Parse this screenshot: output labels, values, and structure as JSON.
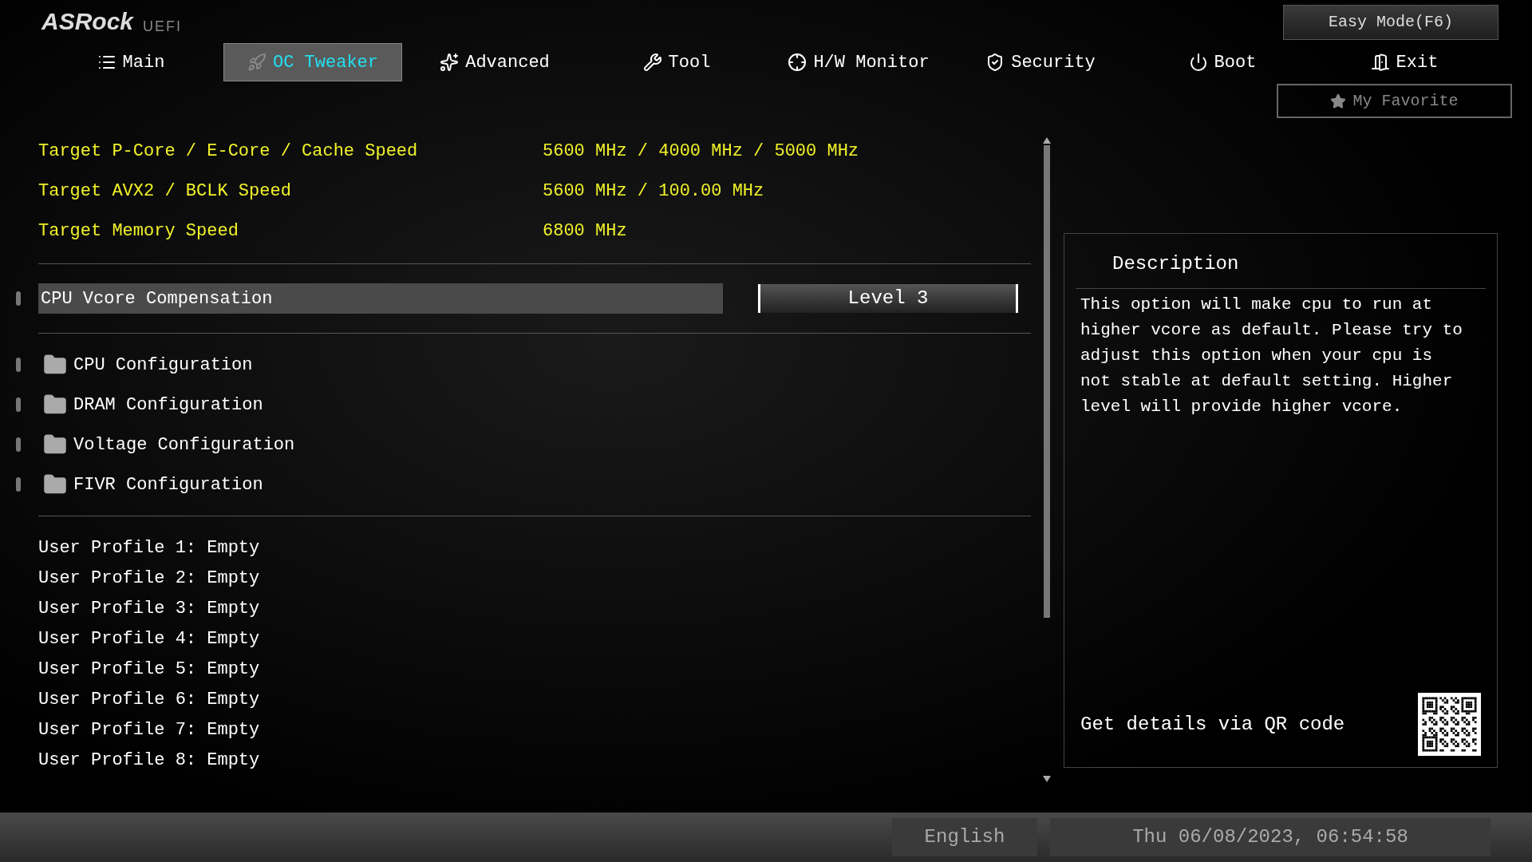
{
  "header": {
    "logo": "ASRock",
    "logo_suffix": "UEFI",
    "easy_mode": "Easy Mode(F6)",
    "favorite": "My Favorite"
  },
  "tabs": [
    {
      "label": "Main",
      "selected": false
    },
    {
      "label": "OC Tweaker",
      "selected": true
    },
    {
      "label": "Advanced",
      "selected": false
    },
    {
      "label": "Tool",
      "selected": false
    },
    {
      "label": "H/W Monitor",
      "selected": false
    },
    {
      "label": "Security",
      "selected": false
    },
    {
      "label": "Boot",
      "selected": false
    },
    {
      "label": "Exit",
      "selected": false
    }
  ],
  "info_rows": [
    {
      "label": "Target P-Core / E-Core / Cache Speed",
      "value": "5600 MHz / 4000 MHz / 5000 MHz"
    },
    {
      "label": "Target AVX2 / BCLK Speed",
      "value": "5600 MHz / 100.00 MHz"
    },
    {
      "label": "Target Memory Speed",
      "value": "6800 MHz"
    }
  ],
  "setting": {
    "label": "CPU Vcore Compensation",
    "value": "Level 3",
    "selected": true
  },
  "submenus": [
    {
      "label": "CPU Configuration",
      "selected": false
    },
    {
      "label": "DRAM Configuration",
      "selected": false
    },
    {
      "label": "Voltage Configuration",
      "selected": false
    },
    {
      "label": "FIVR Configuration",
      "selected": false
    }
  ],
  "profiles": [
    "User Profile 1: Empty",
    "User Profile 2: Empty",
    "User Profile 3: Empty",
    "User Profile 4: Empty",
    "User Profile 5: Empty",
    "User Profile 6: Empty",
    "User Profile 7: Empty",
    "User Profile 8: Empty"
  ],
  "description": {
    "title": "Description",
    "text": "This option will make cpu to run at higher vcore as default. Please try to adjust this option when your cpu is not stable at default setting. Higher level will provide higher vcore.",
    "qr_label": "Get details via QR code"
  },
  "status_bar": {
    "language": "English",
    "datetime": "Thu 06/08/2023, 06:54:58"
  }
}
